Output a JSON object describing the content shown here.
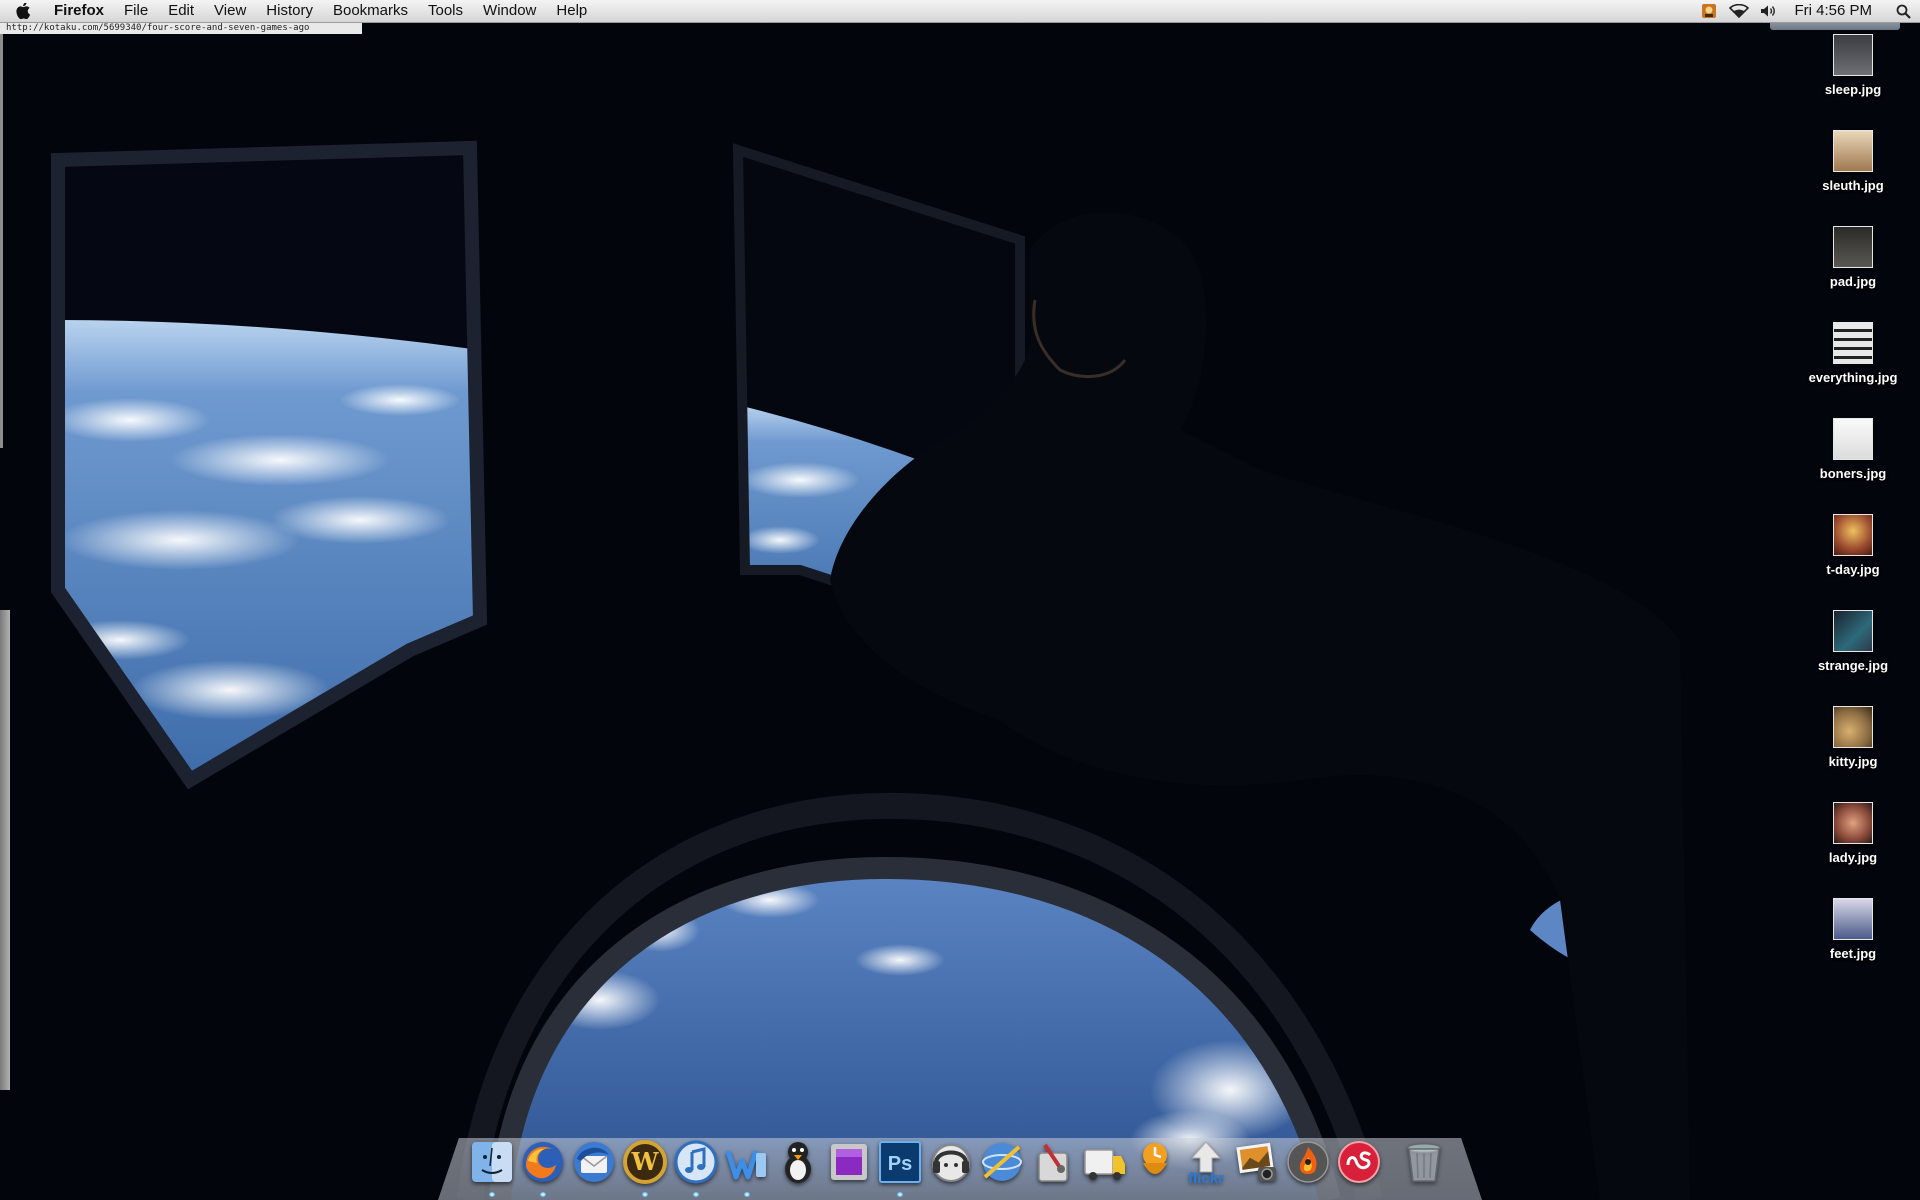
{
  "menubar": {
    "app_name": "Firefox",
    "menus": [
      "File",
      "Edit",
      "View",
      "History",
      "Bookmarks",
      "Tools",
      "Window",
      "Help"
    ],
    "clock": "Fri 4:56 PM",
    "tray_icons": [
      "photo-app-icon",
      "wifi-icon",
      "volume-icon"
    ]
  },
  "status_bar": {
    "url": "http://kotaku.com/5699340/four-score-and-seven-games-ago"
  },
  "desktop": {
    "wallpaper": "iss-cupola-earth-view",
    "files": [
      {
        "label": "sleep.jpg",
        "tint": "#6d6f74"
      },
      {
        "label": "sleuth.jpg",
        "tint": "#a07850"
      },
      {
        "label": "pad.jpg",
        "tint": "#5a5852"
      },
      {
        "label": "everything.jpg",
        "tint": "#e8e8e8"
      },
      {
        "label": "boners.jpg",
        "tint": "#f0f0f0"
      },
      {
        "label": "t-day.jpg",
        "tint": "#9a4a2e"
      },
      {
        "label": "strange.jpg",
        "tint": "#2d3a4a"
      },
      {
        "label": "kitty.jpg",
        "tint": "#8a6a40"
      },
      {
        "label": "lady.jpg",
        "tint": "#8a4a3a"
      },
      {
        "label": "feet.jpg",
        "tint": "#4a5a8a"
      }
    ]
  },
  "dock": {
    "items": [
      {
        "name": "finder-icon",
        "running": true
      },
      {
        "name": "firefox-icon",
        "running": true
      },
      {
        "name": "thunderbird-icon",
        "running": false
      },
      {
        "name": "world-of-warcraft-icon",
        "running": true
      },
      {
        "name": "itunes-icon",
        "running": true
      },
      {
        "name": "word-icon",
        "running": true
      },
      {
        "name": "adium-icon",
        "running": false
      },
      {
        "name": "purple-app-icon",
        "running": false
      },
      {
        "name": "photoshop-icon",
        "running": true
      },
      {
        "name": "headset-app-icon",
        "running": false
      },
      {
        "name": "network-app-icon",
        "running": false
      },
      {
        "name": "utility-app-icon",
        "running": false
      },
      {
        "name": "transmit-icon",
        "running": false
      },
      {
        "name": "growl-icon",
        "running": false
      },
      {
        "name": "flickr-uploadr-icon",
        "running": false
      },
      {
        "name": "iphoto-icon",
        "running": false
      },
      {
        "name": "burn-icon",
        "running": false
      },
      {
        "name": "lastfm-icon",
        "running": false
      },
      {
        "name": "trash-icon",
        "running": false
      }
    ],
    "flickr_text": "flickr",
    "ps_text": "Ps",
    "wow_text": "W"
  }
}
